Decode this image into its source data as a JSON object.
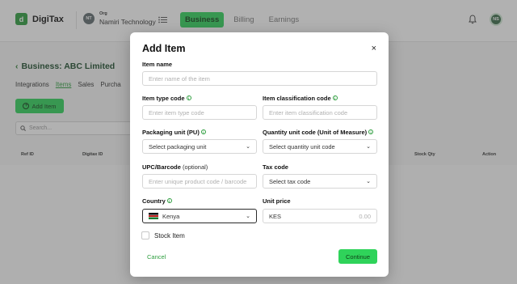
{
  "app": {
    "name": "DigiTax",
    "logo_letter": "d"
  },
  "org": {
    "caption": "Org",
    "name": "Namiri Technology",
    "initials": "NT"
  },
  "nav": {
    "tabs": [
      {
        "label": "Business",
        "active": true
      },
      {
        "label": "Billing"
      },
      {
        "label": "Earnings"
      }
    ]
  },
  "user": {
    "initials": "NS"
  },
  "page": {
    "title": "Business: ABC Limited",
    "tabs": [
      "Integrations",
      "Items",
      "Sales",
      "Purcha"
    ],
    "add_button": "Add Item",
    "search_placeholder": "Search...",
    "columns": [
      "Ref ID",
      "Digitax ID",
      "Stock Qty",
      "Action"
    ]
  },
  "modal": {
    "title": "Add Item",
    "close": "×",
    "item_name": {
      "label": "Item name",
      "placeholder": "Enter name of the item"
    },
    "item_type": {
      "label": "Item type code",
      "placeholder": "Enter item type code"
    },
    "item_class": {
      "label": "Item classification code",
      "placeholder": "Enter item classification code"
    },
    "packaging": {
      "label": "Packaging unit (PU)",
      "value": "Select packaging unit"
    },
    "quantity": {
      "label": "Quantity unit code (Unit of Measure)",
      "value": "Select quantity unit code"
    },
    "barcode": {
      "label": "UPC/Barcode",
      "optional": "(optional)",
      "placeholder": "Enter unique product code / barcode"
    },
    "tax_code": {
      "label": "Tax code",
      "value": "Select tax code"
    },
    "country": {
      "label": "Country",
      "value": "Kenya"
    },
    "unit_price": {
      "label": "Unit price",
      "currency": "KES",
      "value": "0.00"
    },
    "stock_item": "Stock Item",
    "cancel": "Cancel",
    "continue": "Continue"
  },
  "colors": {
    "accent": "#2fd35a",
    "brand_green": "#2e9e3f",
    "overlay": "#464646"
  }
}
